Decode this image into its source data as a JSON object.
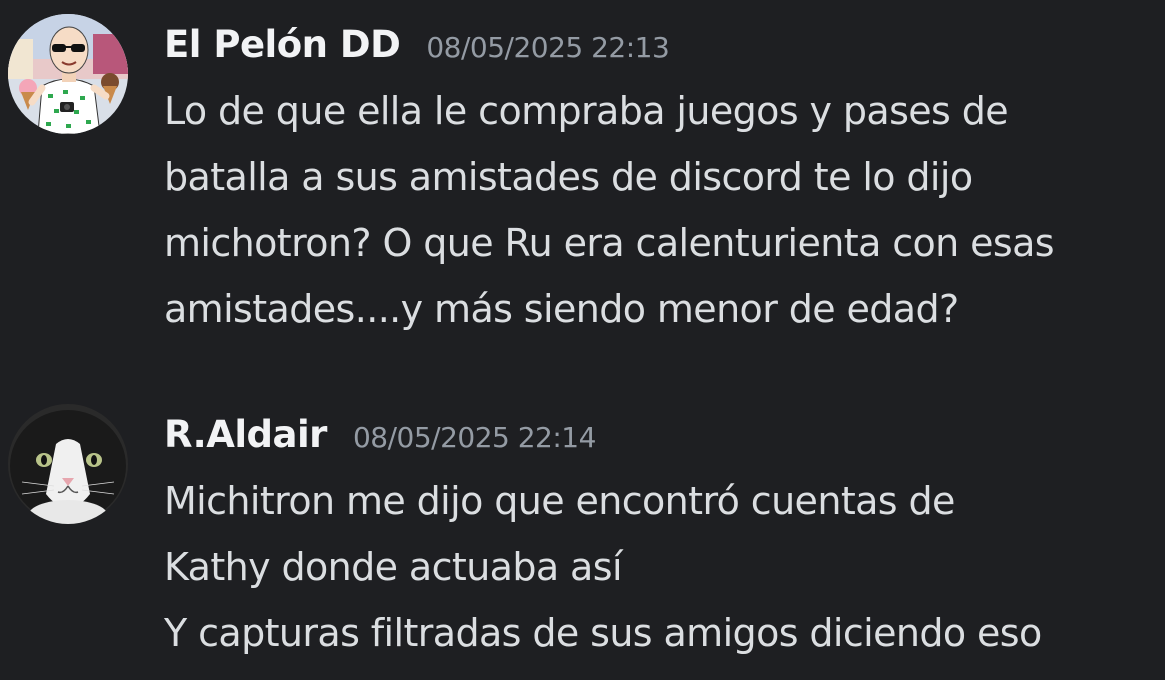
{
  "messages": [
    {
      "author": "El Pelón DD",
      "timestamp": "08/05/2025 22:13",
      "lines": [
        "Lo de que ella le compraba juegos y pases de",
        "batalla a sus amistades de discord te lo dijo",
        "michotron? O que Ru era calenturienta con esas",
        "amistades....y más siendo menor de edad?"
      ]
    },
    {
      "author": "R.Aldair",
      "timestamp": "08/05/2025 22:14",
      "lines": [
        "Michitron me dijo que encontró cuentas de",
        "Kathy donde actuaba así",
        "Y capturas filtradas de sus amigos diciendo eso"
      ]
    }
  ],
  "colors": {
    "background": "#1e1f22",
    "username": "#f2f3f5",
    "timestamp": "#949ba4",
    "message_text": "#dbdee1"
  },
  "icons": {
    "avatar_1": "anime-bald-man-with-sunglasses-avatar",
    "avatar_2": "black-and-white-cat-avatar"
  }
}
